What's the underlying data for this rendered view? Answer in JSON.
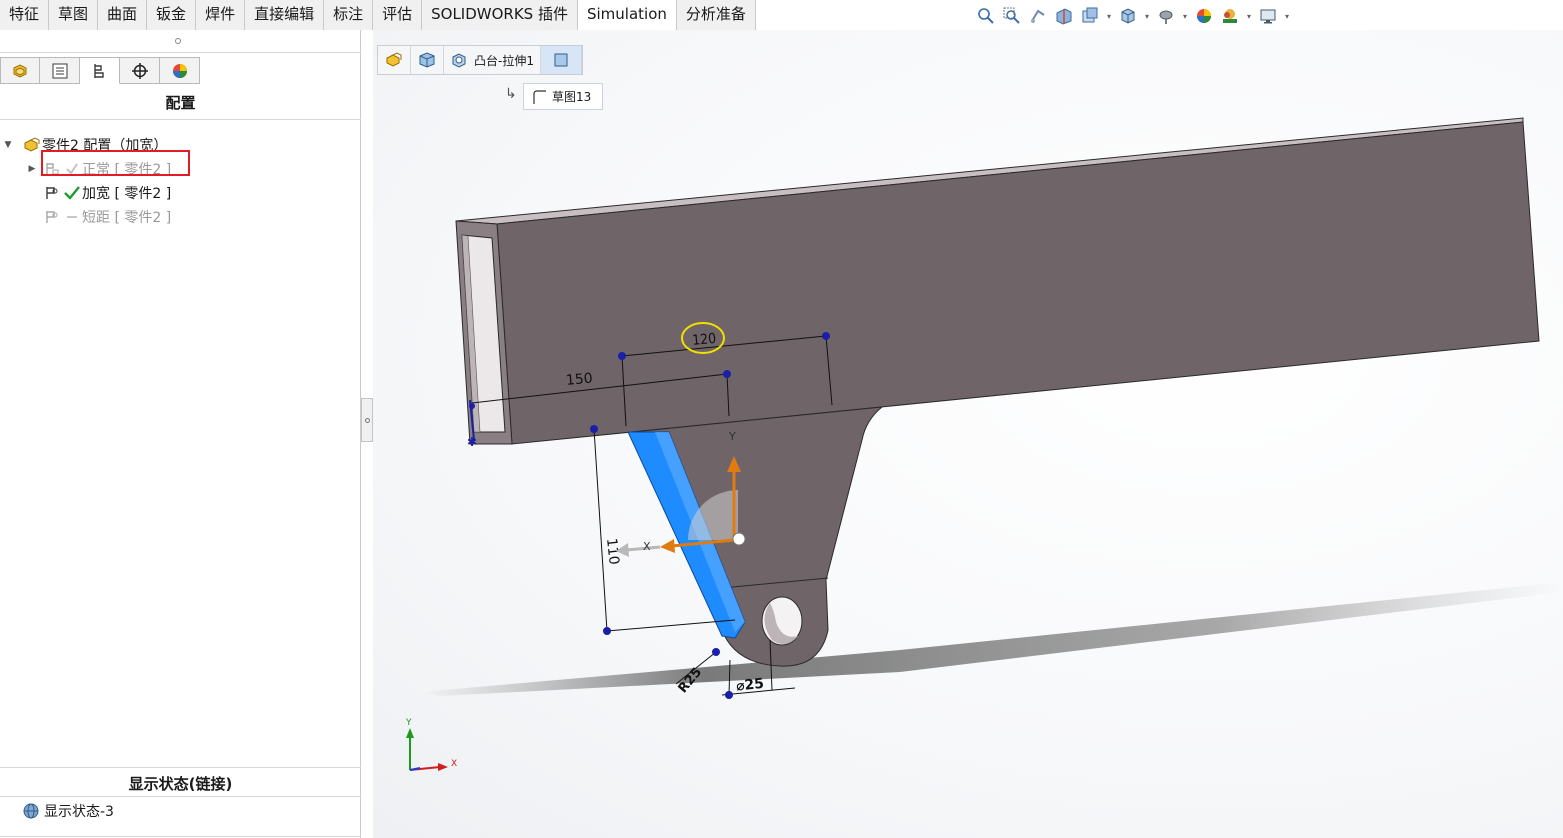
{
  "command_tabs": [
    {
      "label": "特征"
    },
    {
      "label": "草图"
    },
    {
      "label": "曲面"
    },
    {
      "label": "钣金"
    },
    {
      "label": "焊件"
    },
    {
      "label": "直接编辑"
    },
    {
      "label": "标注"
    },
    {
      "label": "评估"
    },
    {
      "label": "SOLIDWORKS 插件"
    },
    {
      "label": "Simulation"
    },
    {
      "label": "分析准备"
    }
  ],
  "view_toolbar_icons": [
    "zoom-to-fit-icon",
    "zoom-to-area-icon",
    "previous-view-icon",
    "section-view-icon",
    "dynamic-annotation-icon",
    "view-orientation-icon",
    "display-style-icon",
    "hide-show-icon",
    "edit-appearance-icon",
    "apply-scene-icon",
    "view-settings-icon"
  ],
  "left_panel": {
    "title": "配置",
    "tabs": [
      "feature-manager-icon",
      "property-manager-icon",
      "configuration-manager-icon",
      "dim-xpert-icon",
      "display-manager-icon"
    ],
    "tree": {
      "root": "零件2 配置（加宽）",
      "items": [
        {
          "label": "正常 [ 零件2 ]",
          "active": false
        },
        {
          "label": "加宽 [ 零件2 ]",
          "active": true
        },
        {
          "label": "短距 [ 零件2 ]",
          "active": false
        }
      ]
    },
    "display_state_title": "显示状态(链接)",
    "display_state_item": "显示状态-3"
  },
  "breadcrumb": {
    "feature": "凸台-拉伸1",
    "sketch": "草图13"
  },
  "dimensions": {
    "d120": "120",
    "d150": "150",
    "d110": "110",
    "r25": "R25",
    "dia25": "⌀25"
  },
  "axes": {
    "x": "X",
    "y": "Y"
  },
  "colors": {
    "part_body": "#6f6468",
    "sketch_face": "#1e8cff",
    "highlight": "#e31b23",
    "selected_dim_ring": "#f0e000"
  }
}
